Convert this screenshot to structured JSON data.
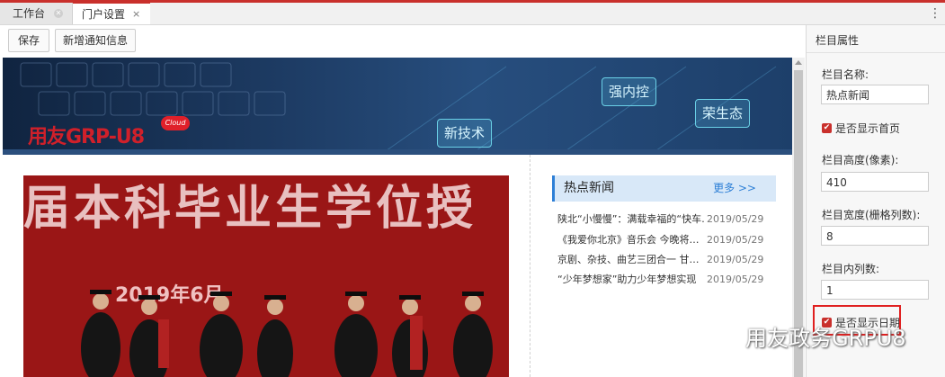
{
  "tabs": [
    {
      "label": "工作台",
      "active": false
    },
    {
      "label": "门户设置",
      "active": true
    }
  ],
  "toolbar": {
    "save_label": "保存",
    "add_notice_label": "新增通知信息"
  },
  "banner": {
    "logo_text": "用友GRP-U8",
    "logo_badge": "Cloud",
    "tags": [
      "强内控",
      "荣生态",
      "新技术"
    ]
  },
  "photo": {
    "headline": "届本科毕业生学位授",
    "year_text": "2019年6月"
  },
  "hot_news": {
    "title": "热点新闻",
    "more": "更多 >>",
    "items": [
      {
        "text": "陕北“小慢慢”：满载幸福的“快车…",
        "date": "2019/05/29"
      },
      {
        "text": "《我爱你北京》音乐会 今晚将…",
        "date": "2019/05/29"
      },
      {
        "text": "京剧、杂技、曲艺三团合一 甘…",
        "date": "2019/05/29"
      },
      {
        "text": "“少年梦想家”助力少年梦想实现",
        "date": "2019/05/29"
      }
    ]
  },
  "panel": {
    "title": "栏目属性",
    "name_label": "栏目名称:",
    "name_value": "热点新闻",
    "show_home_label": "是否显示首页",
    "height_label": "栏目高度(像素):",
    "height_value": "410",
    "width_label": "栏目宽度(栅格列数):",
    "width_value": "8",
    "cols_label": "栏目内列数:",
    "cols_value": "1",
    "show_date_label": "是否显示日期"
  },
  "watermark": {
    "text": "用友政务GRPU8"
  },
  "colors": {
    "accent": "#c9302c",
    "link": "#2d7fd6",
    "highlight_box": "#e02020"
  }
}
